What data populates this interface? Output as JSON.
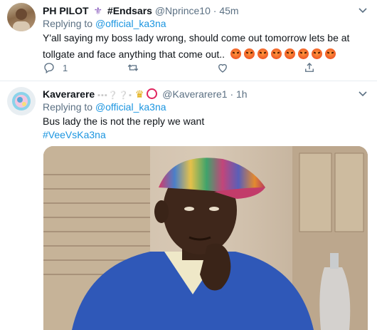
{
  "tweet1": {
    "name": "PH PILOT",
    "hashtag_name": "#Endsars",
    "handle": "@Nprince10",
    "time": "· 45m",
    "replying_label": "Replying to",
    "replying_handle": "@official_ka3na",
    "text_line1": "Y'all saying my boss lady wrong, should come out tomorrow lets be at",
    "text_line2": "tollgate and face anything that come out..",
    "emoji_icon": "angry-face-emoji",
    "emoji_count": 8,
    "reply_count": "1"
  },
  "tweet2": {
    "name": "Kaverarere",
    "handle": "@Kaverarere1",
    "time": "· 1h",
    "replying_label": "Replying to",
    "replying_handle": "@official_ka3na",
    "text_line1": "Bus lady the is not the reply we want",
    "hashtag": "#VeeVsKa3na"
  },
  "colors": {
    "link": "#1b95e0",
    "muted": "#5b7083",
    "text": "#0f1419"
  }
}
